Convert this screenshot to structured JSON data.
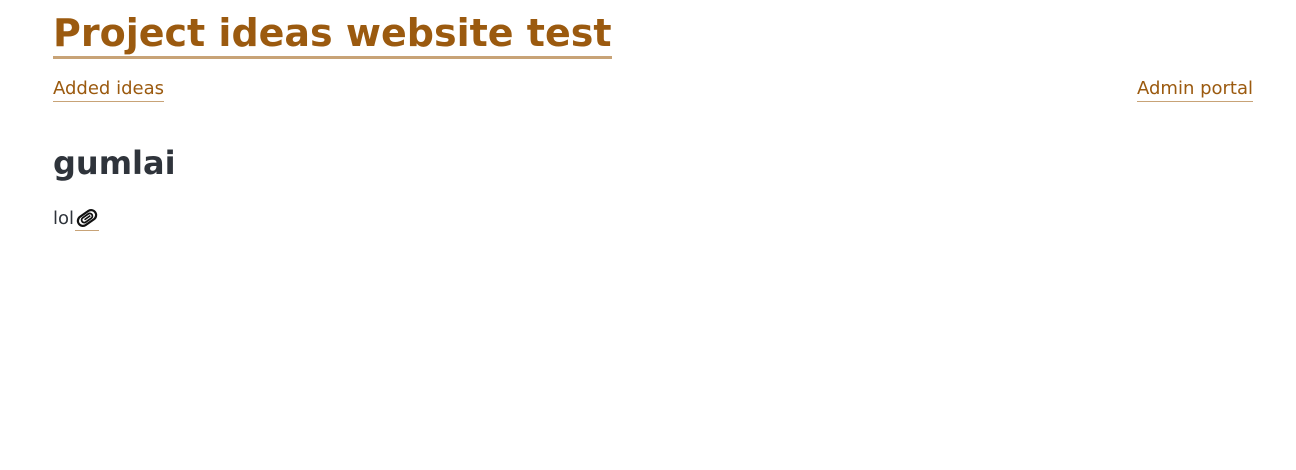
{
  "header": {
    "site_title": "Project ideas website test",
    "nav": {
      "added_ideas": "Added ideas",
      "admin_portal": "Admin portal"
    }
  },
  "idea": {
    "title": "gumlai",
    "description": "lol",
    "attachment_icon": "paperclip-icon"
  },
  "colors": {
    "link": "#9b5a0f",
    "link_underline": "#c8a377",
    "text": "#2f343b",
    "background": "#ffffff"
  }
}
